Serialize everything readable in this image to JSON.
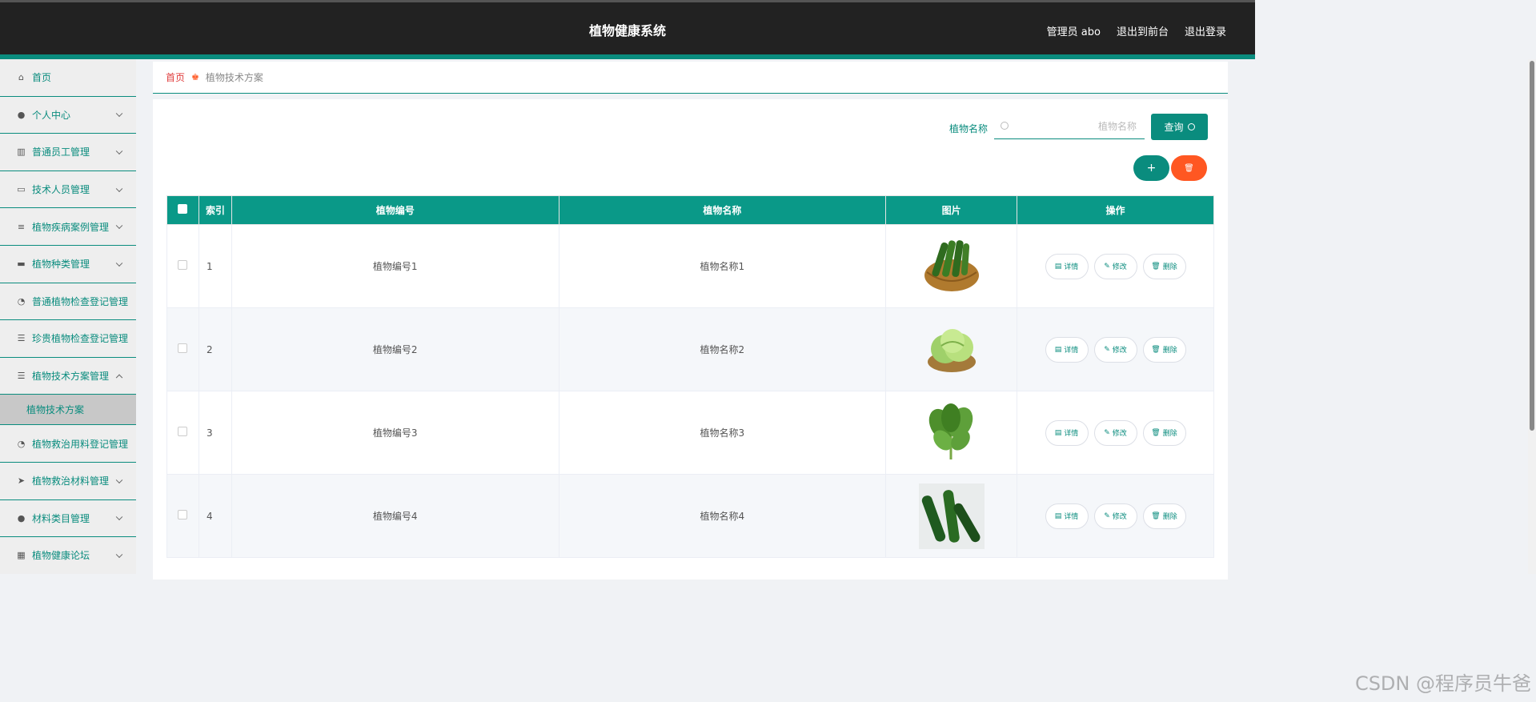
{
  "header": {
    "title": "植物健康系统",
    "links": [
      "管理员 abo",
      "退出到前台",
      "退出登录"
    ]
  },
  "sidebar": {
    "items": [
      {
        "label": "首页",
        "icon": "home-icon"
      },
      {
        "label": "个人中心",
        "icon": "user-icon"
      },
      {
        "label": "普通员工管理",
        "icon": "library-icon"
      },
      {
        "label": "技术人员管理",
        "icon": "chat-icon"
      },
      {
        "label": "植物疾病案例管理",
        "icon": "sliders-icon"
      },
      {
        "label": "植物种类管理",
        "icon": "printer-icon"
      },
      {
        "label": "普通植物检查登记管理",
        "icon": "dashboard-icon"
      },
      {
        "label": "珍贵植物检查登记管理",
        "icon": "list-icon"
      },
      {
        "label": "植物技术方案管理",
        "icon": "align-icon"
      },
      {
        "label": "植物救治用料登记管理",
        "icon": "dashboard-icon"
      },
      {
        "label": "植物救治材料管理",
        "icon": "send-icon"
      },
      {
        "label": "材料类目管理",
        "icon": "user-icon"
      },
      {
        "label": "植物健康论坛",
        "icon": "grid-icon"
      }
    ],
    "active_sub": "植物技术方案"
  },
  "breadcrumb": {
    "home": "首页",
    "current": "植物技术方案"
  },
  "search": {
    "label": "植物名称",
    "placeholder": "植物名称",
    "button": "查询"
  },
  "toolbar": {
    "add": "+",
    "delete": "🗑"
  },
  "table": {
    "headers": [
      "索引",
      "植物编号",
      "植物名称",
      "图片",
      "操作"
    ],
    "rows": [
      {
        "index": "1",
        "code": "植物编号1",
        "name": "植物名称1",
        "image": "cucumber-basket"
      },
      {
        "index": "2",
        "code": "植物编号2",
        "name": "植物名称2",
        "image": "lettuce"
      },
      {
        "index": "3",
        "code": "植物编号3",
        "name": "植物名称3",
        "image": "greens"
      },
      {
        "index": "4",
        "code": "植物编号4",
        "name": "植物名称4",
        "image": "cucumbers"
      }
    ],
    "actions": {
      "detail": "详情",
      "edit": "修改",
      "delete": "删除"
    }
  },
  "watermark": "CSDN @程序员牛爸",
  "colors": {
    "accent": "#0a8c7e",
    "danger": "#ff5722",
    "header_bg": "#222222"
  }
}
